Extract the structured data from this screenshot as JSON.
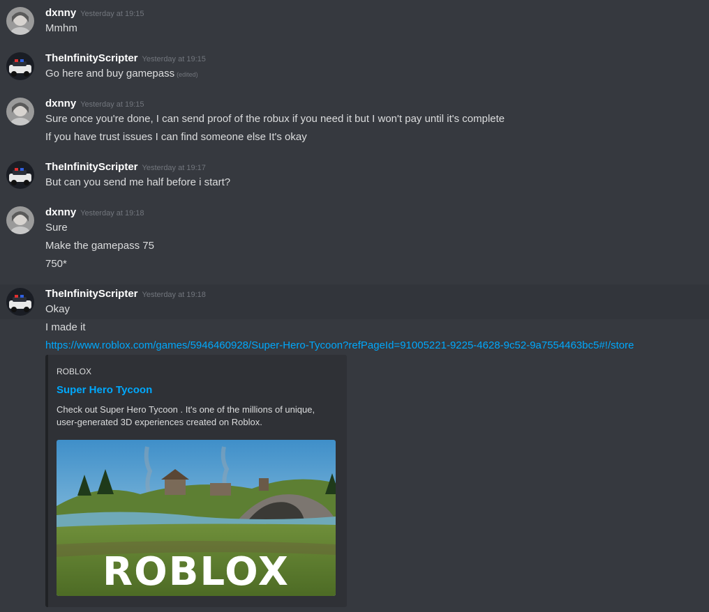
{
  "messages": [
    {
      "author": "dxnny",
      "timestamp": "Yesterday at 19:15",
      "lines": [
        "Mmhm"
      ]
    },
    {
      "author": "TheInfinityScripter",
      "timestamp": "Yesterday at 19:15",
      "lines": [
        "Go here and buy gamepass"
      ],
      "edited": "(edited)"
    },
    {
      "author": "dxnny",
      "timestamp": "Yesterday at 19:15",
      "lines": [
        "Sure once you're done, I can send proof of the robux if you need it but I won't pay until it's complete",
        "If you have trust issues I can find someone else It's okay"
      ]
    },
    {
      "author": "TheInfinityScripter",
      "timestamp": "Yesterday at 19:17",
      "lines": [
        "But can you send me half before i start?"
      ]
    },
    {
      "author": "dxnny",
      "timestamp": "Yesterday at 19:18",
      "lines": [
        "Sure",
        "Make the gamepass 75",
        "750*"
      ]
    },
    {
      "author": "TheInfinityScripter",
      "timestamp": "Yesterday at 19:18",
      "lines": [
        "Okay",
        "I made it"
      ],
      "link": "https://www.roblox.com/games/5946460928/Super-Hero-Tycoon?refPageId=91005221-9225-4628-9c52-9a7554463bc5#!/store"
    }
  ],
  "embed": {
    "provider": "ROBLOX",
    "title": "Super Hero Tycoon",
    "description": "Check out Super Hero Tycoon . It's one of the millions of unique, user-generated 3D experiences created on Roblox.",
    "image_logo_text": "ROBLOX"
  },
  "colors": {
    "background": "#36393f",
    "username": "#ffffff",
    "timestamp": "#72767d",
    "link": "#00a8fc",
    "embed_bg": "#2f3136"
  }
}
